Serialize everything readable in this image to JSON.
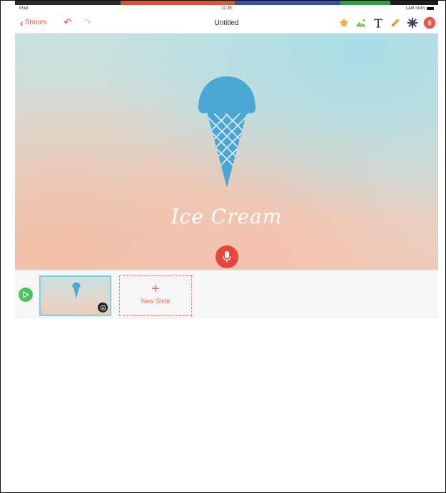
{
  "status_bar": {
    "device": "iPad",
    "time": "11:35",
    "charging": "Lädt nicht"
  },
  "nav": {
    "back_label": "Stories",
    "title": "Untitled"
  },
  "toolbar_icons": [
    "star-icon",
    "image-icon",
    "text-icon",
    "pencil-icon",
    "sticker-icon",
    "record-icon"
  ],
  "slide": {
    "title": "Ice Cream"
  },
  "tray": {
    "new_slide_label": "New Slide"
  },
  "colors": {
    "accent": "#e8564f",
    "cone": "#4aa7d4",
    "play": "#4cc35a",
    "mic": "#e9453f",
    "thumb_border": "#7ecde3"
  }
}
